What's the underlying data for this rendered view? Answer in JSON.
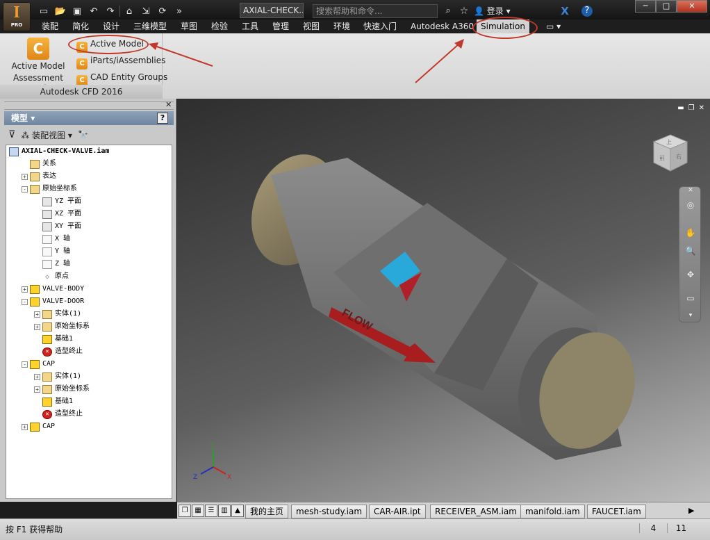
{
  "app": {
    "logo_letter": "I",
    "logo_badge": "PRO"
  },
  "title_bar": {
    "document_title": "AXIAL-CHECK...",
    "search_placeholder": "搜索帮助和命令...",
    "login_label": "登录"
  },
  "menu": {
    "items": [
      "装配",
      "简化",
      "设计",
      "三维模型",
      "草图",
      "检验",
      "工具",
      "管理",
      "视图",
      "环境",
      "快速入门",
      "Autodesk A360"
    ],
    "active_tab": "Simulation"
  },
  "ribbon": {
    "big_button": {
      "line1": "Active Model",
      "line2": "Assessment Tool"
    },
    "small_buttons": [
      "Active Model",
      "iParts/iAssemblies",
      "CAD Entity Groups"
    ],
    "panel_title": "Autodesk CFD 2016"
  },
  "browser": {
    "title": "模型",
    "view_label": "装配视图",
    "tree": [
      {
        "label": "AXIAL-CHECK-VALVE.iam",
        "icon": "assembly-icon",
        "level": 0,
        "toggle": ""
      },
      {
        "label": "关系",
        "icon": "folder-icon",
        "level": 1,
        "toggle": ""
      },
      {
        "label": "表达",
        "icon": "folder-icon",
        "level": 1,
        "toggle": "+"
      },
      {
        "label": "原始坐标系",
        "icon": "folder-open-icon",
        "level": 1,
        "toggle": "-"
      },
      {
        "label": "YZ 平面",
        "icon": "plane-icon",
        "level": 2,
        "toggle": ""
      },
      {
        "label": "XZ 平面",
        "icon": "plane-icon",
        "level": 2,
        "toggle": ""
      },
      {
        "label": "XY 平面",
        "icon": "plane-icon",
        "level": 2,
        "toggle": ""
      },
      {
        "label": "X 轴",
        "icon": "axis-icon",
        "level": 2,
        "toggle": ""
      },
      {
        "label": "Y 轴",
        "icon": "axis-icon",
        "level": 2,
        "toggle": ""
      },
      {
        "label": "Z 轴",
        "icon": "axis-icon",
        "level": 2,
        "toggle": ""
      },
      {
        "label": "原点",
        "icon": "point-icon",
        "level": 2,
        "toggle": ""
      },
      {
        "label": "VALVE-BODY",
        "icon": "part-icon",
        "level": 1,
        "toggle": "+"
      },
      {
        "label": "VALVE-DOOR",
        "icon": "part-icon",
        "level": 1,
        "toggle": "-"
      },
      {
        "label": "实体(1)",
        "icon": "folder-icon",
        "level": 2,
        "toggle": "+"
      },
      {
        "label": "原始坐标系",
        "icon": "folder-icon",
        "level": 2,
        "toggle": "+"
      },
      {
        "label": "基础1",
        "icon": "part-icon",
        "level": 2,
        "toggle": ""
      },
      {
        "label": "造型终止",
        "icon": "end-of-part-icon",
        "level": 2,
        "toggle": ""
      },
      {
        "label": "CAP",
        "icon": "part-icon",
        "level": 1,
        "toggle": "-"
      },
      {
        "label": "实体(1)",
        "icon": "folder-icon",
        "level": 2,
        "toggle": "+"
      },
      {
        "label": "原始坐标系",
        "icon": "folder-icon",
        "level": 2,
        "toggle": "+"
      },
      {
        "label": "基础1",
        "icon": "part-icon",
        "level": 2,
        "toggle": ""
      },
      {
        "label": "造型终止",
        "icon": "end-of-part-icon",
        "level": 2,
        "toggle": ""
      },
      {
        "label": "CAP",
        "icon": "part-icon",
        "level": 1,
        "toggle": "+"
      }
    ]
  },
  "viewport": {
    "viewcube_faces": [
      "上",
      "前",
      "右"
    ],
    "model_label": "FLOW",
    "triad": {
      "x": "X",
      "y": "Y",
      "z": "Z"
    },
    "colors": {
      "body": "#7a7a7a",
      "cap": "#8e8468",
      "flow_red": "#a81e1e",
      "logo_blue": "#29a9d9"
    }
  },
  "document_tabs": [
    "我的主页",
    "mesh-study.iam",
    "CAR-AIR.ipt",
    "RECEIVER_ASM.iam",
    "manifold.iam",
    "FAUCET.iam"
  ],
  "status_bar": {
    "help_text": "按 F1 获得帮助",
    "count1": "4",
    "count2": "11"
  }
}
